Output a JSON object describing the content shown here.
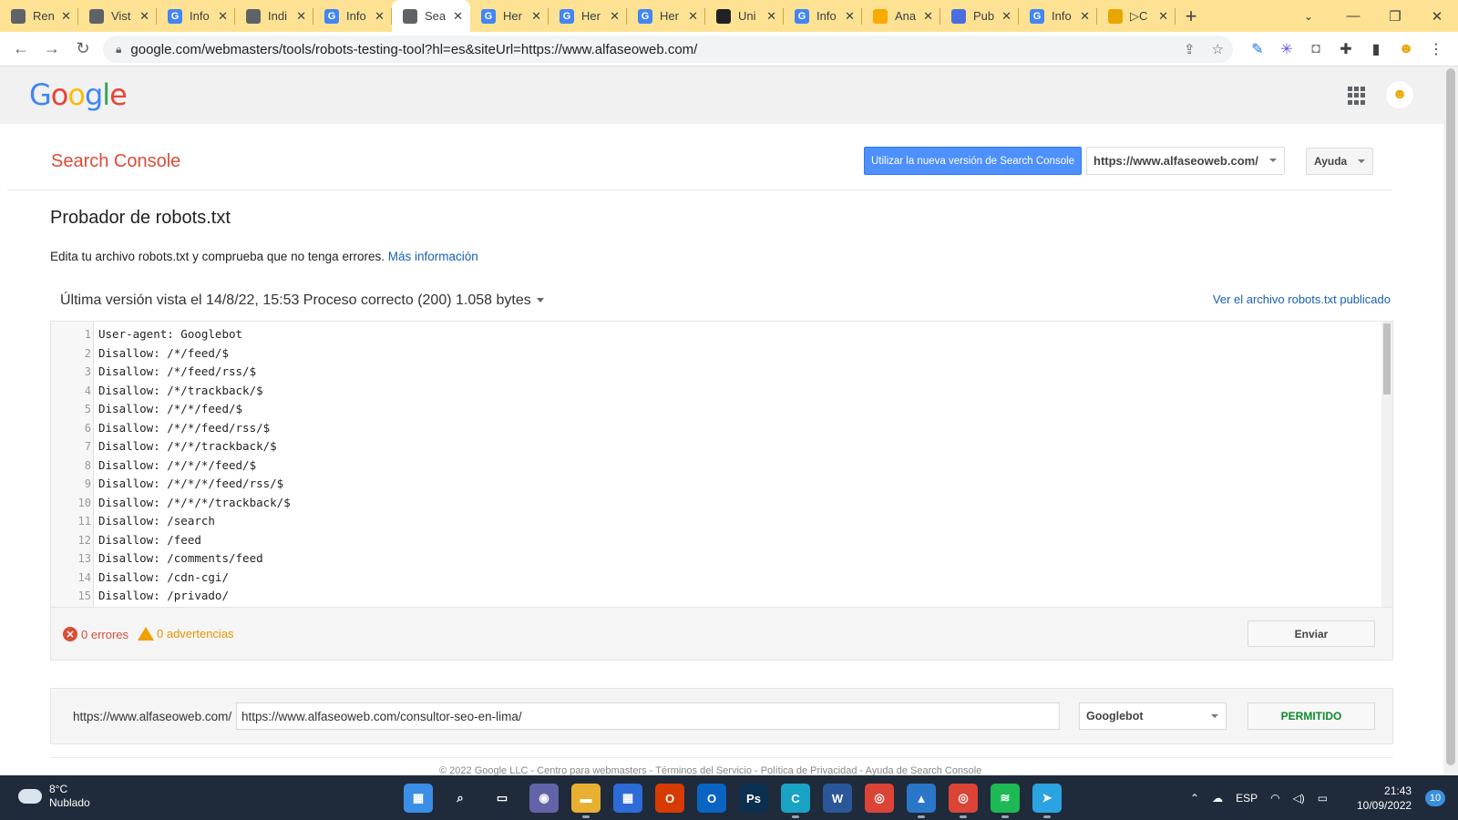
{
  "browser": {
    "tabs": [
      {
        "title": "Ren",
        "favicon": "hat-icon",
        "color": "#5f6368"
      },
      {
        "title": "Vist",
        "favicon": "hat-icon",
        "color": "#5f6368"
      },
      {
        "title": "Info",
        "favicon": "google-icon",
        "color": "#4285f4"
      },
      {
        "title": "Indi",
        "favicon": "hat-icon",
        "color": "#5f6368"
      },
      {
        "title": "Info",
        "favicon": "google-icon",
        "color": "#4285f4"
      },
      {
        "title": "Sea",
        "favicon": "search-console-icon",
        "color": "#5f6368",
        "active": true
      },
      {
        "title": "Her",
        "favicon": "google-icon",
        "color": "#4285f4"
      },
      {
        "title": "Her",
        "favicon": "google-icon",
        "color": "#4285f4"
      },
      {
        "title": "Her",
        "favicon": "google-icon",
        "color": "#4285f4"
      },
      {
        "title": "Uni",
        "favicon": "code-icon",
        "color": "#202124"
      },
      {
        "title": "Info",
        "favicon": "google-icon",
        "color": "#4285f4"
      },
      {
        "title": "Ana",
        "favicon": "analytics-icon",
        "color": "#f9ab00"
      },
      {
        "title": "Pub",
        "favicon": "publisher-icon",
        "color": "#4a6ee0"
      },
      {
        "title": "Info",
        "favicon": "google-icon",
        "color": "#4285f4"
      },
      {
        "title": "▷C",
        "favicon": "avatar-icon",
        "color": "#e8a600"
      }
    ],
    "new_tab": "+",
    "url": "google.com/webmasters/tools/robots-testing-tool?hl=es&siteUrl=https://www.alfaseoweb.com/"
  },
  "header": {
    "logo": [
      {
        "ch": "G",
        "color": "#4285f4"
      },
      {
        "ch": "o",
        "color": "#ea4335"
      },
      {
        "ch": "o",
        "color": "#fbbc05"
      },
      {
        "ch": "g",
        "color": "#4285f4"
      },
      {
        "ch": "l",
        "color": "#34a853"
      },
      {
        "ch": "e",
        "color": "#ea4335"
      }
    ]
  },
  "console": {
    "title": "Search Console",
    "new_version_button": "Utilizar la nueva versión de Search Console",
    "property": "https://www.alfaseoweb.com/",
    "help": "Ayuda"
  },
  "page": {
    "title": "Probador de robots.txt",
    "description": "Edita tu archivo robots.txt y comprueba que no tenga errores.",
    "more_info": "Más información",
    "version_info": "Última versión vista el 14/8/22, 15:53 Proceso correcto (200) 1.058 bytes",
    "view_published": "Ver el archivo robots.txt publicado"
  },
  "editor": {
    "lines": [
      "User-agent: Googlebot",
      "Disallow: /*/feed/$",
      "Disallow: /*/feed/rss/$",
      "Disallow: /*/trackback/$",
      "Disallow: /*/*/feed/$",
      "Disallow: /*/*/feed/rss/$",
      "Disallow: /*/*/trackback/$",
      "Disallow: /*/*/*/feed/$",
      "Disallow: /*/*/*/feed/rss/$",
      "Disallow: /*/*/*/trackback/$",
      "Disallow: /search",
      "Disallow: /feed",
      "Disallow: /comments/feed",
      "Disallow: /cdn-cgi/",
      "Disallow: /privado/"
    ]
  },
  "status": {
    "errors": "0 errores",
    "warnings": "0 advertencias",
    "send": "Enviar"
  },
  "test": {
    "prefix": "https://www.alfaseoweb.com/",
    "url_value": "https://www.alfaseoweb.com/consultor-seo-en-lima/",
    "agent": "Googlebot",
    "result": "PERMITIDO",
    "result_color": "#0a8a2a"
  },
  "footer": "© 2022 Google LLC - Centro para webmasters - Términos del Servicio - Política de Privacidad - Ayuda de Search Console",
  "taskbar": {
    "temp": "8°C",
    "weather": "Nublado",
    "lang": "ESP",
    "time": "21:43",
    "date": "10/09/2022",
    "notifications": "10",
    "apps": [
      {
        "name": "windows-start-icon",
        "glyph": "▦",
        "color": "#3a8ee6"
      },
      {
        "name": "search-icon",
        "glyph": "⌕",
        "color": "#1f2a3a"
      },
      {
        "name": "task-view-icon",
        "glyph": "▭",
        "color": "#1f2a3a"
      },
      {
        "name": "teams-chat-icon",
        "glyph": "◉",
        "color": "#6264a7"
      },
      {
        "name": "file-explorer-icon",
        "glyph": "▬",
        "color": "#e8b030",
        "open": true
      },
      {
        "name": "store-icon",
        "glyph": "▦",
        "color": "#2d6bd6"
      },
      {
        "name": "office-icon",
        "glyph": "O",
        "color": "#d83b01"
      },
      {
        "name": "outlook-icon",
        "glyph": "O",
        "color": "#0a64c2"
      },
      {
        "name": "photoshop-icon",
        "glyph": "Ps",
        "color": "#0b2f4e"
      },
      {
        "name": "canva-icon",
        "glyph": "C",
        "color": "#1ba3c6",
        "open": true
      },
      {
        "name": "word-icon",
        "glyph": "W",
        "color": "#2b579a"
      },
      {
        "name": "chrome-icon",
        "glyph": "◎",
        "color": "#db4437"
      },
      {
        "name": "photos-icon",
        "glyph": "▲",
        "color": "#2a76c9",
        "open": true
      },
      {
        "name": "chrome-profile-icon",
        "glyph": "◎",
        "color": "#db4437",
        "open": true
      },
      {
        "name": "spotify-icon",
        "glyph": "≋",
        "color": "#1db954",
        "open": true
      },
      {
        "name": "telegram-icon",
        "glyph": "➤",
        "color": "#2aa3e0",
        "open": true
      }
    ]
  }
}
